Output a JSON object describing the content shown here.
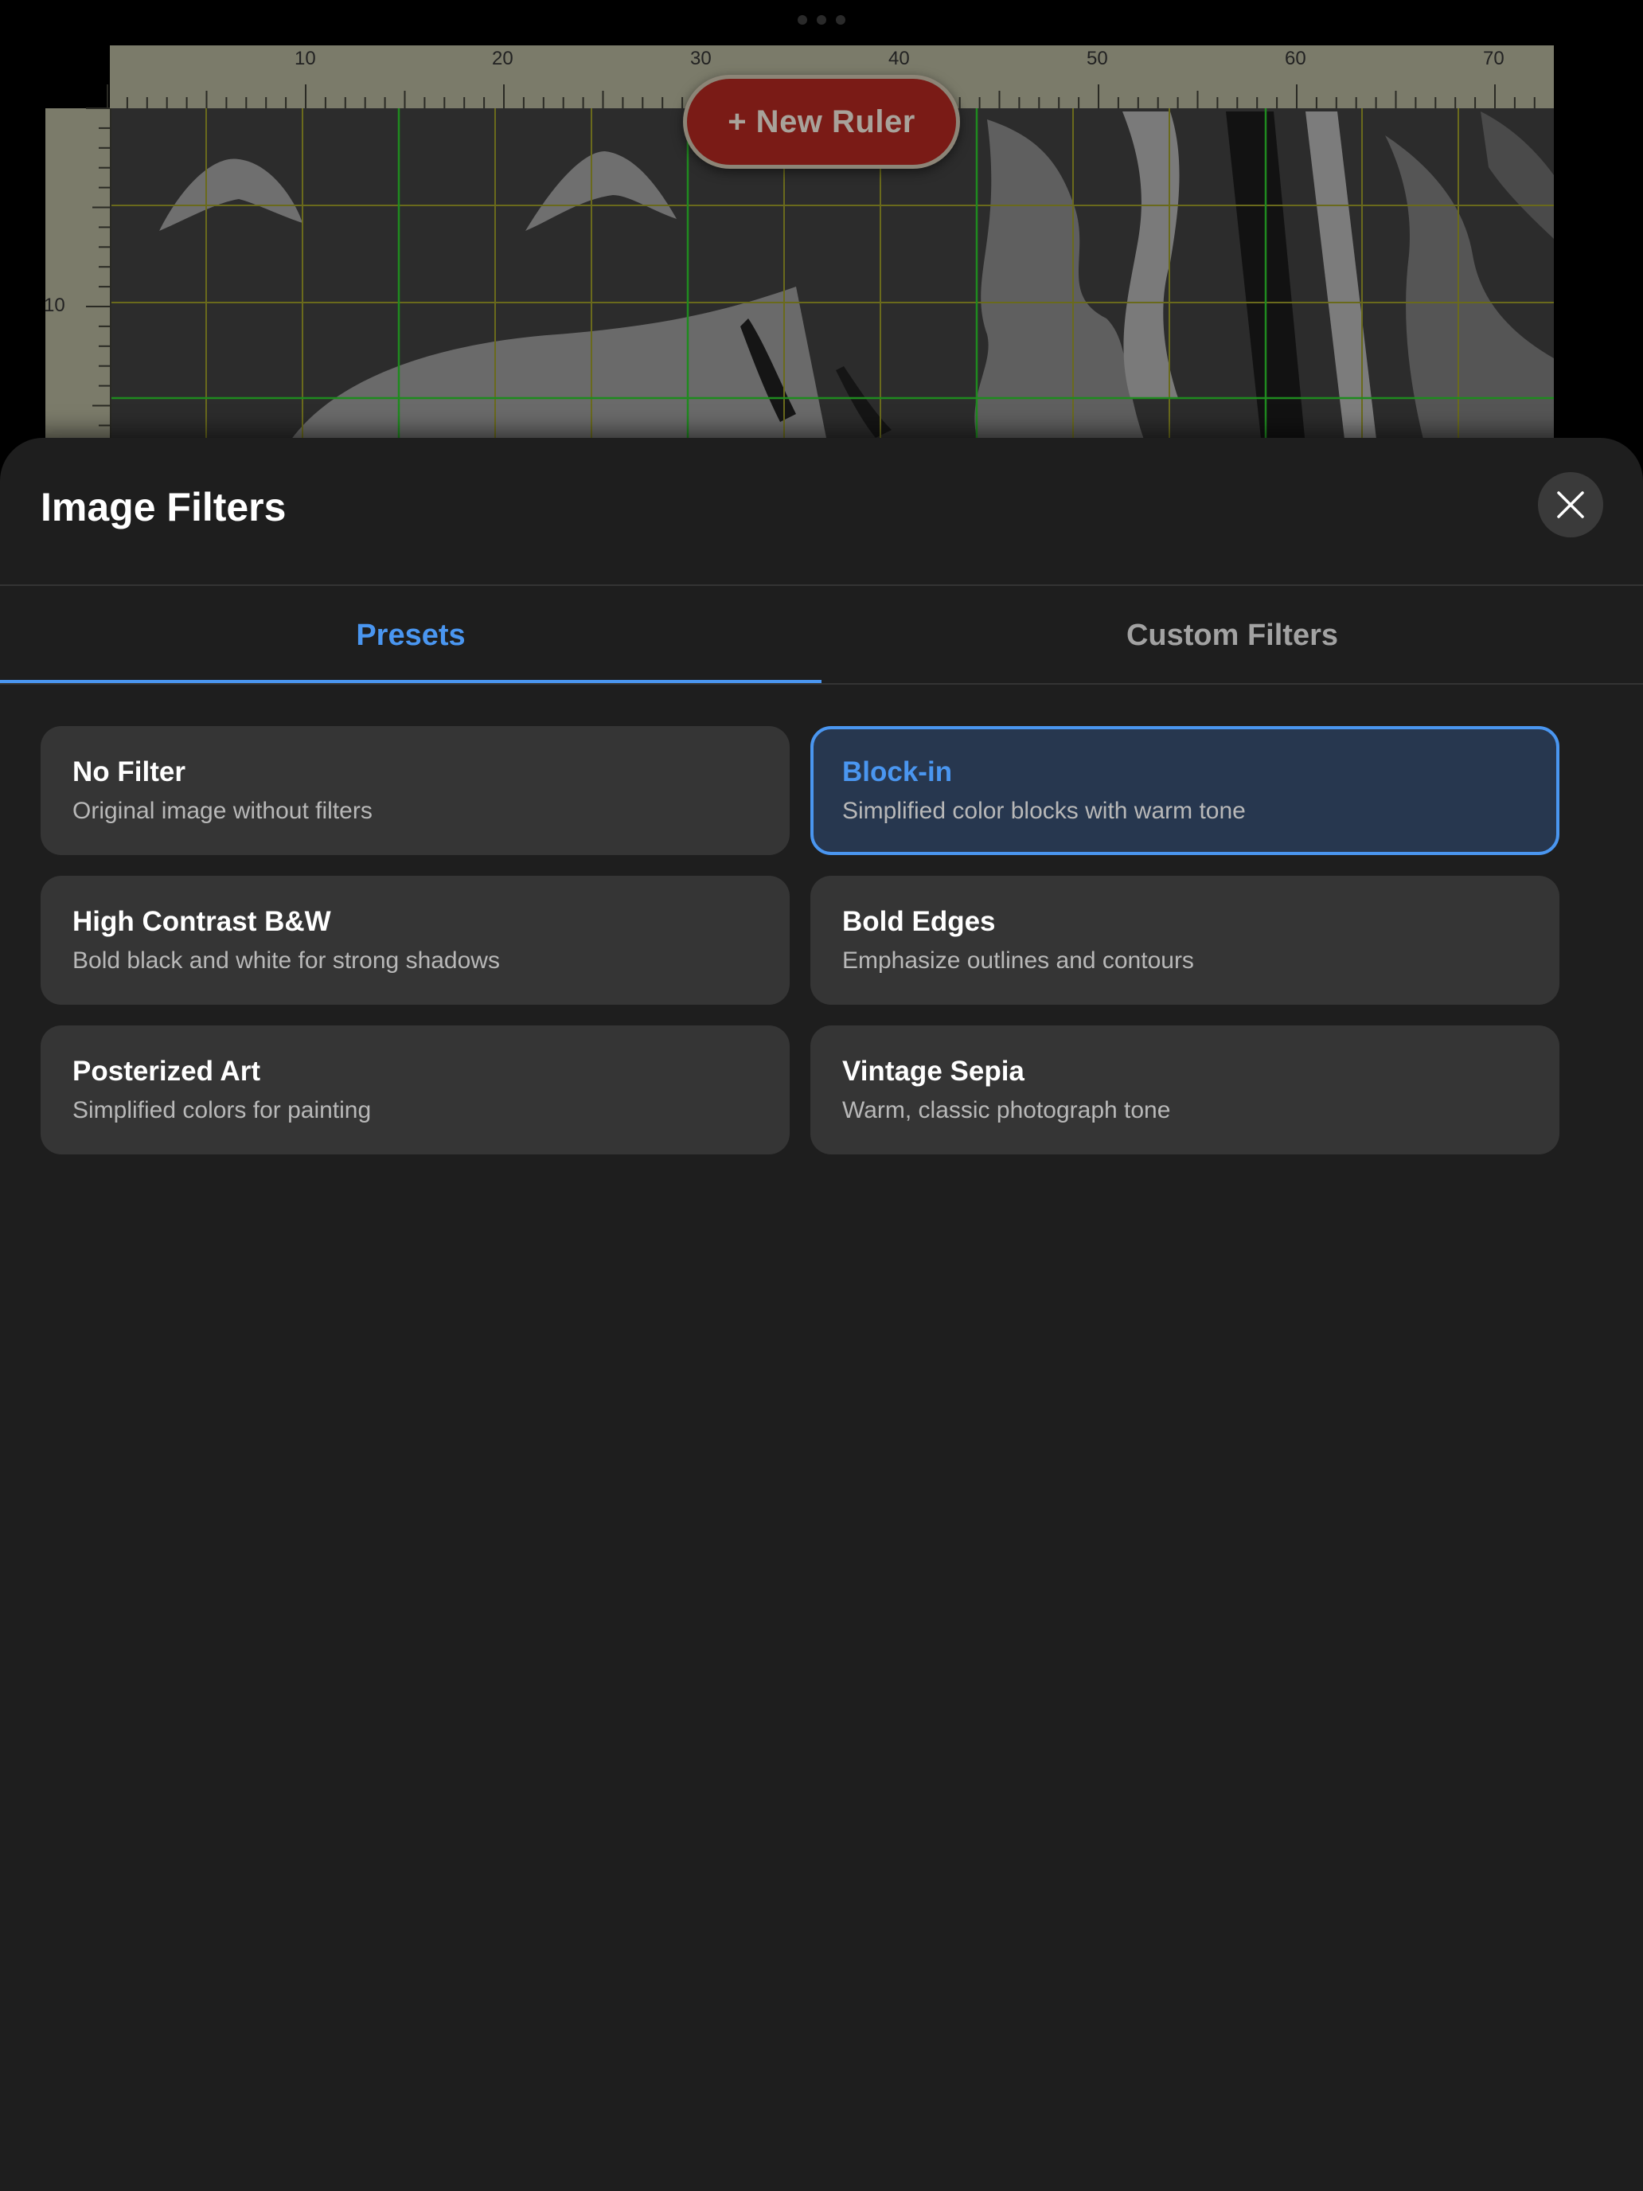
{
  "canvas": {
    "top_ruler_ticks": [
      "10",
      "20",
      "30",
      "40",
      "50",
      "60",
      "70"
    ],
    "left_ruler_ticks": [
      "10"
    ],
    "new_ruler_label": "+ New Ruler"
  },
  "sheet": {
    "title": "Image Filters",
    "close_icon": "close-icon"
  },
  "tabs": [
    {
      "label": "Presets",
      "active": true
    },
    {
      "label": "Custom Filters",
      "active": false
    }
  ],
  "presets": [
    {
      "title": "No Filter",
      "description": "Original image without filters",
      "selected": false
    },
    {
      "title": "Block-in",
      "description": "Simplified color blocks with warm tone",
      "selected": true
    },
    {
      "title": "High Contrast B&W",
      "description": "Bold black and white for strong shadows",
      "selected": false
    },
    {
      "title": "Bold Edges",
      "description": "Emphasize outlines and contours",
      "selected": false
    },
    {
      "title": "Posterized Art",
      "description": "Simplified colors for painting",
      "selected": false
    },
    {
      "title": "Vintage Sepia",
      "description": "Warm, classic photograph tone",
      "selected": false
    }
  ],
  "colors": {
    "accent": "#4a96f0",
    "sheet_bg": "#1e1e1e",
    "card_bg": "#353535",
    "selected_card_bg": "#27374f",
    "new_ruler_bg": "#7a1b16"
  }
}
